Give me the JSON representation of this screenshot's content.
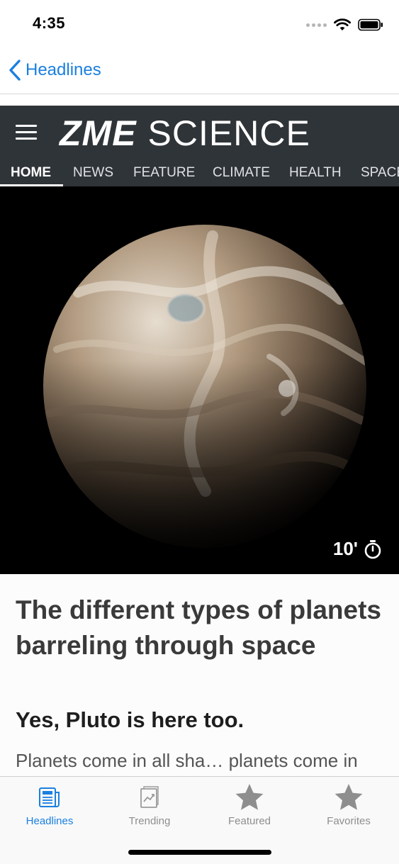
{
  "status": {
    "time": "4:35"
  },
  "nav": {
    "back_label": "Headlines"
  },
  "site": {
    "brand_bold": "ZME",
    "brand_light": "SCIENCE",
    "nav_items": [
      "HOME",
      "NEWS",
      "FEATURE",
      "CLIMATE",
      "HEALTH",
      "SPACE"
    ],
    "active_item": "HOME"
  },
  "hero": {
    "read_time": "10'"
  },
  "article": {
    "title": "The different types of planets barreling through space",
    "subtitle": "Yes, Pluto is here too.",
    "excerpt": "Planets come in all sha… planets come in"
  },
  "tabs": [
    {
      "label": "Headlines",
      "icon": "newspaper-icon",
      "active": true
    },
    {
      "label": "Trending",
      "icon": "trending-chart-icon",
      "active": false
    },
    {
      "label": "Featured",
      "icon": "star-icon",
      "active": false
    },
    {
      "label": "Favorites",
      "icon": "star-icon",
      "active": false
    }
  ],
  "colors": {
    "accent": "#1a7fe0",
    "header_bg": "#2f3438",
    "inactive_tab": "#8e8e8e"
  }
}
